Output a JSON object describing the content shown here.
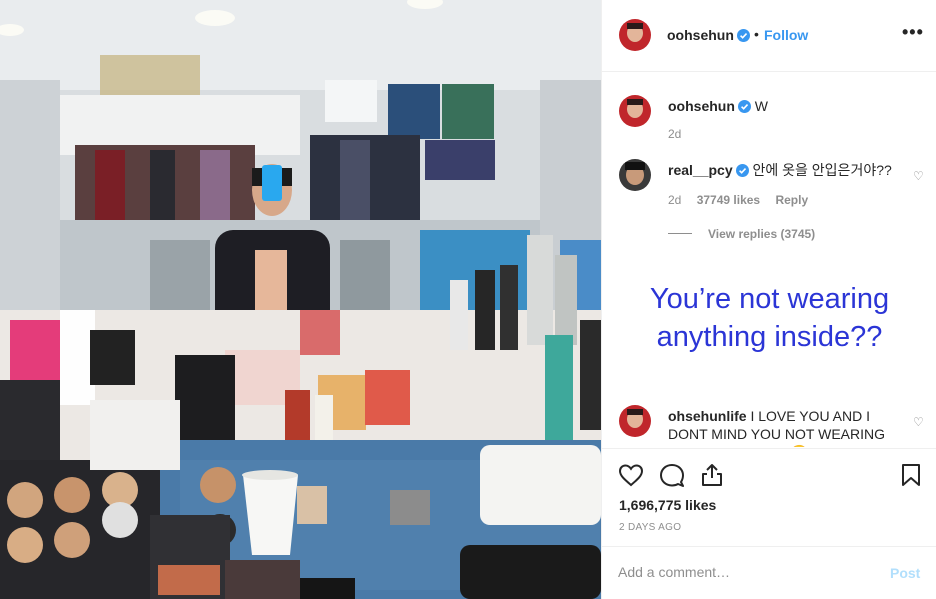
{
  "header": {
    "username": "oohsehun",
    "separator": "•",
    "follow_label": "Follow",
    "more_label": "•••"
  },
  "comments": [
    {
      "username": "oohsehun",
      "text": "W",
      "meta": {
        "age": "2d"
      }
    },
    {
      "username": "real__pcy",
      "text": "안에 옷을 안입은거야??",
      "meta": {
        "age": "2d",
        "likes": "37749 likes",
        "reply": "Reply"
      },
      "view_replies": "View replies (3745)"
    },
    {
      "username": "ohsehunlife",
      "text": "I LOVE YOU AND I DONT MIND YOU NOT WEARING ANYTHING INSIDE😂"
    }
  ],
  "overlay_caption": "You’re not wearing anything inside??",
  "actions": {
    "likes": "1,696,775 likes",
    "time": "2 DAYS AGO"
  },
  "add_comment": {
    "placeholder": "Add a comment…",
    "post_label": "Post"
  },
  "colors": {
    "accent": "#3897f0",
    "caption": "#2b35d6",
    "muted": "#8e8e8e",
    "post_disabled": "#b2dffc"
  },
  "icons": [
    "heart-icon",
    "comment-icon",
    "share-icon",
    "bookmark-icon",
    "verified-icon",
    "more-icon"
  ]
}
